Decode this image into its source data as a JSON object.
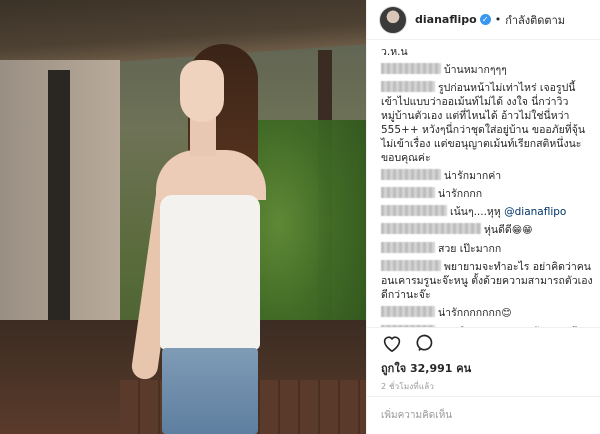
{
  "header": {
    "username": "dianaflipo",
    "follow_status": "กำลังติดตาม"
  },
  "comments": [
    {
      "blur": 0,
      "text": "ว.ห.น"
    },
    {
      "blur": 60,
      "text": "บ้านหมากๆๆๆ"
    },
    {
      "blur": 54,
      "text": "รูปก่อนหน้าไม่เท่าไหร่ เจอรูปนี้เข้าไปแบบว่าออเม้นท์ไม่ได้ งงใจ นี่กว่าวิวหมู่บ้านตัวเอง แต่ที่ไหนได้ อ้าวไม่ใช่นี่หว่า 555++ หวังๆนี่กว่าชุดใส่อยู่บ้าน ขออภัยที่จุ้นไม่เข้าเรื่อง แต่ขอนุญาตเม้นท์เรียกสติหนึ่งนะ ขอบคุณค่ะ"
    },
    {
      "blur": 60,
      "text": "น่ารักมากค่า"
    },
    {
      "blur": 54,
      "text": "น่ารักกกก"
    },
    {
      "blur": 66,
      "text": "เน้นๆ....หุหุ",
      "mention": "@dianaflipo"
    },
    {
      "blur": 100,
      "text": "หุ่นดีดี",
      "emoji": "😁😁"
    },
    {
      "blur": 54,
      "text": "สวย เป๊ะมากก"
    },
    {
      "blur": 60,
      "text": "พยายามจะทำอะไร อย่าคิดว่าคนอนเคารมรูนะจ๊ะหนู ตั้งด้วยความสามารถตัวเองดีกว่านะจ๊ะ"
    },
    {
      "blur": 54,
      "text": "น่ารักกกกกกก",
      "emoji": "😊"
    },
    {
      "blur": 54,
      "text": "เอาจริงๆนะคะ ขนาดตัวแฟนเค้ายังไม่ค่อยจะลงรูปอะไรเวลาแวะไปหากันที่บ้านเลย.."
    }
  ],
  "actions": {
    "like_icon": "heart-icon",
    "comment_icon": "comment-icon"
  },
  "likes_text": "ถูกใจ 32,991 คน",
  "time_text": "2 ชั่วโมงที่แล้ว",
  "add_comment_placeholder": "เพิ่มความคิดเห็น"
}
